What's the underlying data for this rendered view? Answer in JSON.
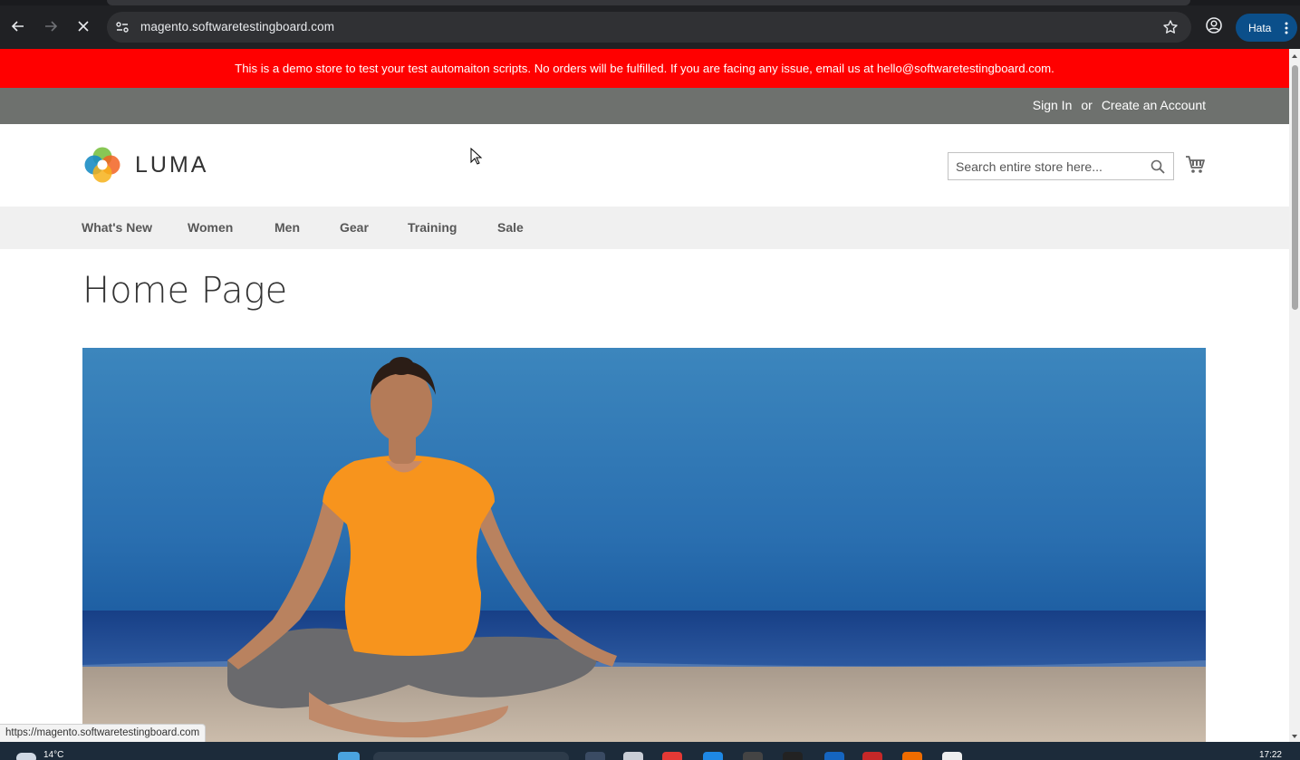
{
  "browser": {
    "url": "magento.softwaretestingboard.com",
    "profile_label": "Hata",
    "status_url": "https://magento.softwaretestingboard.com"
  },
  "store": {
    "demo_notice": "This is a demo store to test your test automaiton scripts. No orders will be fulfilled. If you are facing any issue, email us at hello@softwaretestingboard.com.",
    "header_links": {
      "sign_in": "Sign In",
      "or": "or",
      "create_account": "Create an Account"
    },
    "logo_text": "LUMA",
    "search": {
      "placeholder": "Search entire store here..."
    },
    "nav": {
      "items": [
        {
          "label": "What's New"
        },
        {
          "label": "Women"
        },
        {
          "label": "Men"
        },
        {
          "label": "Gear"
        },
        {
          "label": "Training"
        },
        {
          "label": "Sale"
        }
      ]
    },
    "page_title": "Home Page",
    "colors": {
      "notice_bg": "#ff0000",
      "header_panel_bg": "#6e716e",
      "nav_bg": "#f0f0f0"
    }
  },
  "taskbar": {
    "weather": "14°C",
    "time": "17:22"
  }
}
